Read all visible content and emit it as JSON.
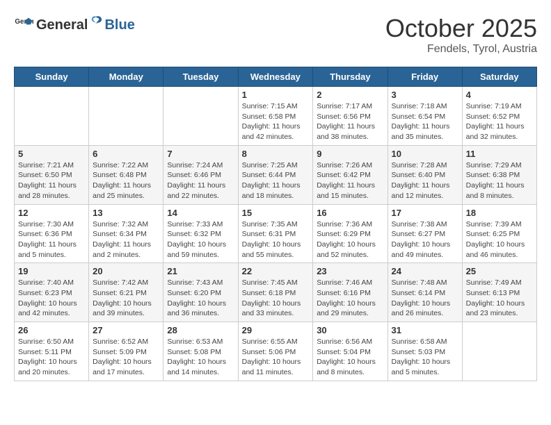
{
  "header": {
    "logo_general": "General",
    "logo_blue": "Blue",
    "month": "October 2025",
    "location": "Fendels, Tyrol, Austria"
  },
  "days_of_week": [
    "Sunday",
    "Monday",
    "Tuesday",
    "Wednesday",
    "Thursday",
    "Friday",
    "Saturday"
  ],
  "weeks": [
    [
      {
        "day": "",
        "info": ""
      },
      {
        "day": "",
        "info": ""
      },
      {
        "day": "",
        "info": ""
      },
      {
        "day": "1",
        "info": "Sunrise: 7:15 AM\nSunset: 6:58 PM\nDaylight: 11 hours and 42 minutes."
      },
      {
        "day": "2",
        "info": "Sunrise: 7:17 AM\nSunset: 6:56 PM\nDaylight: 11 hours and 38 minutes."
      },
      {
        "day": "3",
        "info": "Sunrise: 7:18 AM\nSunset: 6:54 PM\nDaylight: 11 hours and 35 minutes."
      },
      {
        "day": "4",
        "info": "Sunrise: 7:19 AM\nSunset: 6:52 PM\nDaylight: 11 hours and 32 minutes."
      }
    ],
    [
      {
        "day": "5",
        "info": "Sunrise: 7:21 AM\nSunset: 6:50 PM\nDaylight: 11 hours and 28 minutes."
      },
      {
        "day": "6",
        "info": "Sunrise: 7:22 AM\nSunset: 6:48 PM\nDaylight: 11 hours and 25 minutes."
      },
      {
        "day": "7",
        "info": "Sunrise: 7:24 AM\nSunset: 6:46 PM\nDaylight: 11 hours and 22 minutes."
      },
      {
        "day": "8",
        "info": "Sunrise: 7:25 AM\nSunset: 6:44 PM\nDaylight: 11 hours and 18 minutes."
      },
      {
        "day": "9",
        "info": "Sunrise: 7:26 AM\nSunset: 6:42 PM\nDaylight: 11 hours and 15 minutes."
      },
      {
        "day": "10",
        "info": "Sunrise: 7:28 AM\nSunset: 6:40 PM\nDaylight: 11 hours and 12 minutes."
      },
      {
        "day": "11",
        "info": "Sunrise: 7:29 AM\nSunset: 6:38 PM\nDaylight: 11 hours and 8 minutes."
      }
    ],
    [
      {
        "day": "12",
        "info": "Sunrise: 7:30 AM\nSunset: 6:36 PM\nDaylight: 11 hours and 5 minutes."
      },
      {
        "day": "13",
        "info": "Sunrise: 7:32 AM\nSunset: 6:34 PM\nDaylight: 11 hours and 2 minutes."
      },
      {
        "day": "14",
        "info": "Sunrise: 7:33 AM\nSunset: 6:32 PM\nDaylight: 10 hours and 59 minutes."
      },
      {
        "day": "15",
        "info": "Sunrise: 7:35 AM\nSunset: 6:31 PM\nDaylight: 10 hours and 55 minutes."
      },
      {
        "day": "16",
        "info": "Sunrise: 7:36 AM\nSunset: 6:29 PM\nDaylight: 10 hours and 52 minutes."
      },
      {
        "day": "17",
        "info": "Sunrise: 7:38 AM\nSunset: 6:27 PM\nDaylight: 10 hours and 49 minutes."
      },
      {
        "day": "18",
        "info": "Sunrise: 7:39 AM\nSunset: 6:25 PM\nDaylight: 10 hours and 46 minutes."
      }
    ],
    [
      {
        "day": "19",
        "info": "Sunrise: 7:40 AM\nSunset: 6:23 PM\nDaylight: 10 hours and 42 minutes."
      },
      {
        "day": "20",
        "info": "Sunrise: 7:42 AM\nSunset: 6:21 PM\nDaylight: 10 hours and 39 minutes."
      },
      {
        "day": "21",
        "info": "Sunrise: 7:43 AM\nSunset: 6:20 PM\nDaylight: 10 hours and 36 minutes."
      },
      {
        "day": "22",
        "info": "Sunrise: 7:45 AM\nSunset: 6:18 PM\nDaylight: 10 hours and 33 minutes."
      },
      {
        "day": "23",
        "info": "Sunrise: 7:46 AM\nSunset: 6:16 PM\nDaylight: 10 hours and 29 minutes."
      },
      {
        "day": "24",
        "info": "Sunrise: 7:48 AM\nSunset: 6:14 PM\nDaylight: 10 hours and 26 minutes."
      },
      {
        "day": "25",
        "info": "Sunrise: 7:49 AM\nSunset: 6:13 PM\nDaylight: 10 hours and 23 minutes."
      }
    ],
    [
      {
        "day": "26",
        "info": "Sunrise: 6:50 AM\nSunset: 5:11 PM\nDaylight: 10 hours and 20 minutes."
      },
      {
        "day": "27",
        "info": "Sunrise: 6:52 AM\nSunset: 5:09 PM\nDaylight: 10 hours and 17 minutes."
      },
      {
        "day": "28",
        "info": "Sunrise: 6:53 AM\nSunset: 5:08 PM\nDaylight: 10 hours and 14 minutes."
      },
      {
        "day": "29",
        "info": "Sunrise: 6:55 AM\nSunset: 5:06 PM\nDaylight: 10 hours and 11 minutes."
      },
      {
        "day": "30",
        "info": "Sunrise: 6:56 AM\nSunset: 5:04 PM\nDaylight: 10 hours and 8 minutes."
      },
      {
        "day": "31",
        "info": "Sunrise: 6:58 AM\nSunset: 5:03 PM\nDaylight: 10 hours and 5 minutes."
      },
      {
        "day": "",
        "info": ""
      }
    ]
  ]
}
